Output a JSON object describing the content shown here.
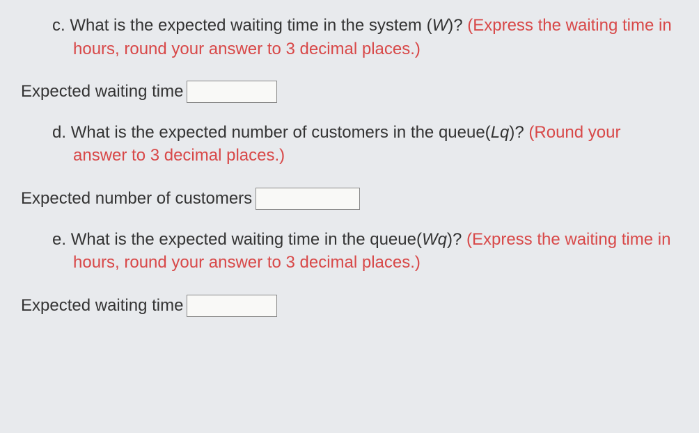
{
  "questions": {
    "c": {
      "label": "c.",
      "text_before_symbol": "What is the expected waiting time in the system (",
      "symbol": "W",
      "text_after_symbol": ")?",
      "instruction": "(Express the waiting time in hours, round your answer to 3 decimal places.)",
      "answer_label": "Expected waiting time",
      "answer_value": ""
    },
    "d": {
      "label": "d.",
      "text_before_symbol": "What is the expected number of customers in the queue(",
      "symbol": "Lq",
      "text_after_symbol": ")?",
      "instruction": "(Round your answer to 3 decimal places.)",
      "answer_label": "Expected number of customers",
      "answer_value": ""
    },
    "e": {
      "label": "e.",
      "text_before_symbol": "What is the expected waiting time in the queue(",
      "symbol": "Wq",
      "text_after_symbol": ")?",
      "instruction": "(Express the waiting time in hours, round your answer to 3 decimal places.)",
      "answer_label": "Expected waiting time",
      "answer_value": ""
    }
  }
}
